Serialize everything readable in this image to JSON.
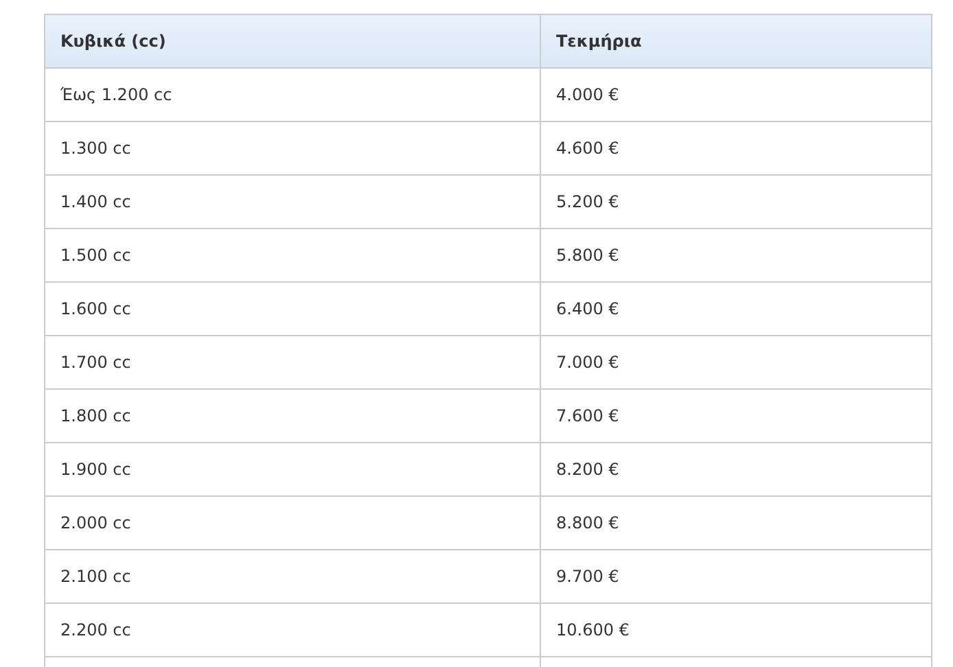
{
  "table": {
    "columns": [
      "Κυβικά (cc)",
      "Τεκμήρια"
    ],
    "rows": [
      [
        "Έως 1.200 cc",
        "4.000 €"
      ],
      [
        "1.300 cc",
        "4.600 €"
      ],
      [
        "1.400 cc",
        "5.200 €"
      ],
      [
        "1.500 cc",
        "5.800 €"
      ],
      [
        "1.600 cc",
        "6.400 €"
      ],
      [
        "1.700 cc",
        "7.000 €"
      ],
      [
        "1.800 cc",
        "7.600 €"
      ],
      [
        "1.900 cc",
        "8.200 €"
      ],
      [
        "2.000 cc",
        "8.800 €"
      ],
      [
        "2.100 cc",
        "9.700 €"
      ],
      [
        "2.200 cc",
        "10.600 €"
      ]
    ]
  }
}
